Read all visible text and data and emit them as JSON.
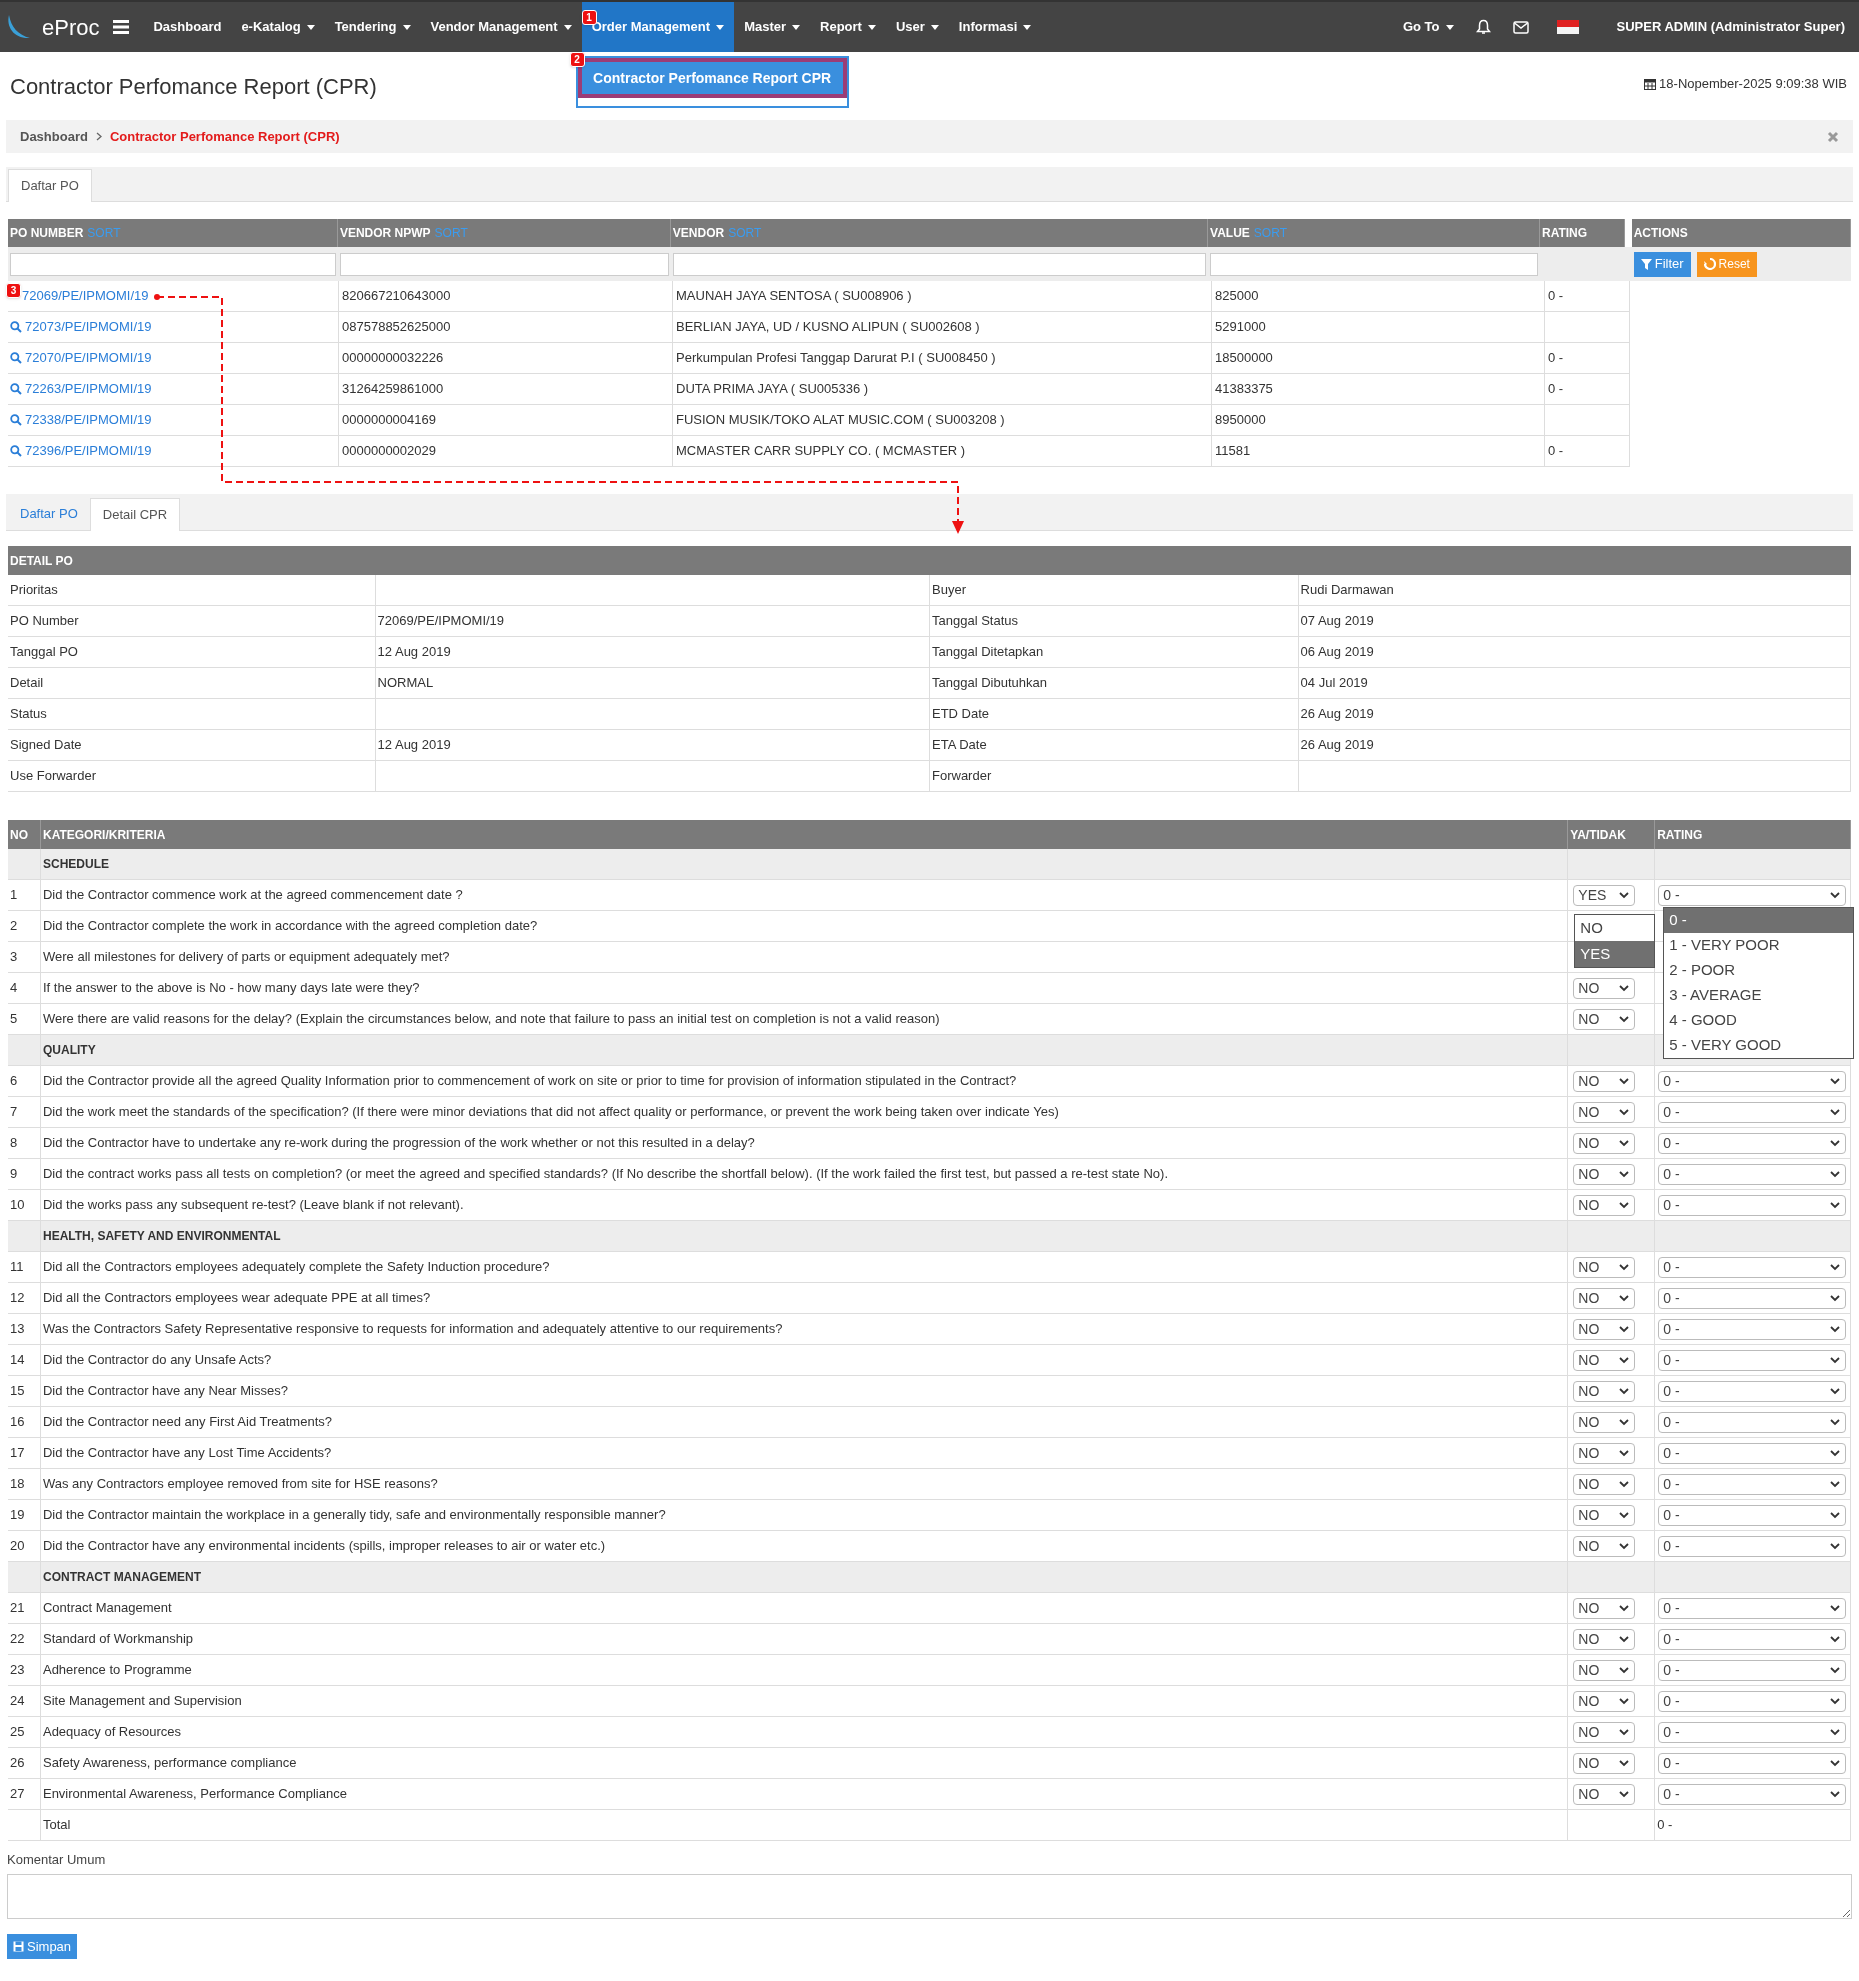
{
  "navbar": {
    "brand": "eProc",
    "menu": [
      {
        "label": "Dashboard",
        "dropdown": false,
        "selected": false
      },
      {
        "label": "e-Katalog",
        "dropdown": true,
        "selected": false
      },
      {
        "label": "Tendering",
        "dropdown": true,
        "selected": false
      },
      {
        "label": "Vendor Management",
        "dropdown": true,
        "selected": false
      },
      {
        "label": "Order Management",
        "dropdown": true,
        "selected": true,
        "badge": "1",
        "submenu": {
          "label": "Contractor Perfomance Report CPR",
          "badge": "2"
        }
      },
      {
        "label": "Master",
        "dropdown": true,
        "selected": false
      },
      {
        "label": "Report",
        "dropdown": true,
        "selected": false
      },
      {
        "label": "User",
        "dropdown": true,
        "selected": false
      },
      {
        "label": "Informasi",
        "dropdown": true,
        "selected": false
      }
    ],
    "goto": "Go To",
    "user": "SUPER ADMIN (Administrator Super)"
  },
  "page_title": "Contractor Perfomance Report (CPR)",
  "datetime": "18-Nopember-2025 9:09:38 WIB",
  "breadcrumb": [
    {
      "label": "Dashboard",
      "current": false
    },
    {
      "label": "Contractor Perfomance Report (CPR)",
      "current": true
    }
  ],
  "tabs_top": [
    {
      "label": "Daftar PO",
      "selected": true
    }
  ],
  "po_table": {
    "columns": [
      {
        "label": "PO NUMBER",
        "sort": "SORT"
      },
      {
        "label": "VENDOR NPWP",
        "sort": "SORT"
      },
      {
        "label": "VENDOR",
        "sort": "SORT"
      },
      {
        "label": "VALUE",
        "sort": "SORT"
      },
      {
        "label": "RATING"
      },
      {
        "label": "ACTIONS"
      }
    ],
    "buttons": {
      "filter": "Filter",
      "reset": "Reset"
    },
    "rows": [
      {
        "po": "72069/PE/IPMOMI/19",
        "npwp": "820667210643000",
        "vendor": "MAUNAH JAYA SENTOSA ( SU008906 )",
        "value": "825000",
        "rating": "0 -",
        "badge": "3"
      },
      {
        "po": "72073/PE/IPMOMI/19",
        "npwp": "087578852625000",
        "vendor": "BERLIAN JAYA, UD / KUSNO ALIPUN ( SU002608 )",
        "value": "5291000"
      },
      {
        "po": "72070/PE/IPMOMI/19",
        "npwp": "00000000032226",
        "vendor": "Perkumpulan Profesi Tanggap Darurat P.I ( SU008450 )",
        "value": "18500000",
        "rating": "0 -"
      },
      {
        "po": "72263/PE/IPMOMI/19",
        "npwp": "31264259861000",
        "vendor": "DUTA PRIMA JAYA ( SU005336 )",
        "value": "41383375",
        "rating": "0 -"
      },
      {
        "po": "72338/PE/IPMOMI/19",
        "npwp": "0000000004169",
        "vendor": "FUSION MUSIK/TOKO ALAT MUSIC.COM ( SU003208 )",
        "value": "8950000"
      },
      {
        "po": "72396/PE/IPMOMI/19",
        "npwp": "0000000002029",
        "vendor": "MCMASTER CARR SUPPLY CO. ( MCMASTER )",
        "value": "11581",
        "rating": "0 -"
      }
    ]
  },
  "tabs_detail": [
    {
      "label": "Daftar PO",
      "selected": false
    },
    {
      "label": "Detail CPR",
      "selected": true
    }
  ],
  "detail_po": {
    "title": "DETAIL PO",
    "rows": [
      {
        "left_label": "Prioritas",
        "right_label": "Buyer",
        "right_value": "Rudi Darmawan"
      },
      {
        "left_label": "PO Number",
        "left_value": "72069/PE/IPMOMI/19",
        "right_label": "Tanggal Status",
        "right_value": "07 Aug 2019"
      },
      {
        "left_label": "Tanggal PO",
        "left_value": "12 Aug 2019",
        "right_label": "Tanggal Ditetapkan",
        "right_value": "06 Aug 2019"
      },
      {
        "left_label": "Detail",
        "left_value": "NORMAL",
        "right_label": "Tanggal Dibutuhkan",
        "right_value": "04 Jul 2019"
      },
      {
        "left_label": "Status",
        "right_label": "ETD Date",
        "right_value": "26 Aug 2019"
      },
      {
        "left_label": "Signed Date",
        "left_value": "12 Aug 2019",
        "right_label": "ETA Date",
        "right_value": "26 Aug 2019"
      },
      {
        "left_label": "Use Forwarder",
        "right_label": "Forwarder"
      }
    ]
  },
  "criteria": {
    "columns": [
      "NO",
      "KATEGORI/KRITERIA",
      "YA/TIDAK",
      "RATING"
    ],
    "rows": [
      {
        "kind": "section",
        "label": "SCHEDULE"
      },
      {
        "kind": "question",
        "no": "1",
        "text": "Did the Contractor commence work at the agreed commencement date ?",
        "answer": "YES",
        "rating": "0 -",
        "answer_options": [
          {
            "label": "NO",
            "selected": false
          },
          {
            "label": "YES",
            "selected": true
          }
        ],
        "rating_options": [
          {
            "label": "0 -",
            "selected": true
          },
          {
            "label": "1 - VERY POOR",
            "selected": false
          },
          {
            "label": "2 - POOR",
            "selected": false
          },
          {
            "label": "3 - AVERAGE",
            "selected": false
          },
          {
            "label": "4 - GOOD",
            "selected": false
          },
          {
            "label": "5 - VERY GOOD",
            "selected": false
          }
        ]
      },
      {
        "kind": "question",
        "no": "2",
        "text": "Did the Contractor complete the work in accordance with the agreed completion date?"
      },
      {
        "kind": "question",
        "no": "3",
        "text": "Were all milestones for delivery of parts or equipment adequately met?"
      },
      {
        "kind": "question",
        "no": "4",
        "text": "If the answer to the above is No - how many days late were they?",
        "answer": "NO"
      },
      {
        "kind": "question",
        "no": "5",
        "text": "Were there are valid reasons for the delay? (Explain the circumstances below, and note that failure to pass an initial test on completion is not a valid reason)",
        "answer": "NO"
      },
      {
        "kind": "section",
        "label": "QUALITY"
      },
      {
        "kind": "question",
        "no": "6",
        "text": "Did the Contractor provide all the agreed Quality Information prior to commencement of work on site or prior to time for provision of information stipulated in the Contract?",
        "answer": "NO",
        "rating": "0 -"
      },
      {
        "kind": "question",
        "no": "7",
        "text": "Did the work meet the standards of the specification? (If there were minor deviations that did not affect quality or performance, or prevent the work being taken over indicate Yes)",
        "answer": "NO",
        "rating": "0 -"
      },
      {
        "kind": "question",
        "no": "8",
        "text": "Did the Contractor have to undertake any re-work during the progression of the work whether or not this resulted in a delay?",
        "answer": "NO",
        "rating": "0 -"
      },
      {
        "kind": "question",
        "no": "9",
        "text": "Did the contract works pass all tests on completion? (or meet the agreed and specified standards? (If No describe the shortfall below). (If the work failed the first test, but passed a re-test state No).",
        "answer": "NO",
        "rating": "0 -"
      },
      {
        "kind": "question",
        "no": "10",
        "text": "Did the works pass any subsequent re-test? (Leave blank if not relevant).",
        "answer": "NO",
        "rating": "0 -"
      },
      {
        "kind": "section",
        "label": "HEALTH, SAFETY AND ENVIRONMENTAL"
      },
      {
        "kind": "question",
        "no": "11",
        "text": "Did all the Contractors employees adequately complete the Safety Induction procedure?",
        "answer": "NO",
        "rating": "0 -"
      },
      {
        "kind": "question",
        "no": "12",
        "text": "Did all the Contractors employees wear adequate PPE at all times?",
        "answer": "NO",
        "rating": "0 -"
      },
      {
        "kind": "question",
        "no": "13",
        "text": "Was the Contractors Safety Representative responsive to requests for information and adequately attentive to our requirements?",
        "answer": "NO",
        "rating": "0 -"
      },
      {
        "kind": "question",
        "no": "14",
        "text": "Did the Contractor do any Unsafe Acts?",
        "answer": "NO",
        "rating": "0 -"
      },
      {
        "kind": "question",
        "no": "15",
        "text": "Did the Contractor have any Near Misses?",
        "answer": "NO",
        "rating": "0 -"
      },
      {
        "kind": "question",
        "no": "16",
        "text": "Did the Contractor need any First Aid Treatments?",
        "answer": "NO",
        "rating": "0 -"
      },
      {
        "kind": "question",
        "no": "17",
        "text": "Did the Contractor have any Lost Time Accidents?",
        "answer": "NO",
        "rating": "0 -"
      },
      {
        "kind": "question",
        "no": "18",
        "text": "Was any Contractors employee removed from site for HSE reasons?",
        "answer": "NO",
        "rating": "0 -"
      },
      {
        "kind": "question",
        "no": "19",
        "text": "Did the Contractor maintain the workplace in a generally tidy, safe and environmentally responsible manner?",
        "answer": "NO",
        "rating": "0 -"
      },
      {
        "kind": "question",
        "no": "20",
        "text": "Did the Contractor have any environmental incidents (spills, improper releases to air or water etc.)",
        "answer": "NO",
        "rating": "0 -"
      },
      {
        "kind": "section",
        "label": "CONTRACT MANAGEMENT"
      },
      {
        "kind": "question",
        "no": "21",
        "text": "Contract Management",
        "answer": "NO",
        "rating": "0 -"
      },
      {
        "kind": "question",
        "no": "22",
        "text": "Standard of Workmanship",
        "answer": "NO",
        "rating": "0 -"
      },
      {
        "kind": "question",
        "no": "23",
        "text": "Adherence to Programme",
        "answer": "NO",
        "rating": "0 -"
      },
      {
        "kind": "question",
        "no": "24",
        "text": "Site Management and Supervision",
        "answer": "NO",
        "rating": "0 -"
      },
      {
        "kind": "question",
        "no": "25",
        "text": "Adequacy of Resources",
        "answer": "NO",
        "rating": "0 -"
      },
      {
        "kind": "question",
        "no": "26",
        "text": "Safety Awareness, performance compliance",
        "answer": "NO",
        "rating": "0 -"
      },
      {
        "kind": "question",
        "no": "27",
        "text": "Environmental Awareness, Performance Compliance",
        "answer": "NO",
        "rating": "0 -"
      },
      {
        "kind": "total",
        "label": "Total",
        "value": "0 -"
      }
    ]
  },
  "comment": {
    "label": "Komentar Umum"
  },
  "save_button": "Simpan"
}
